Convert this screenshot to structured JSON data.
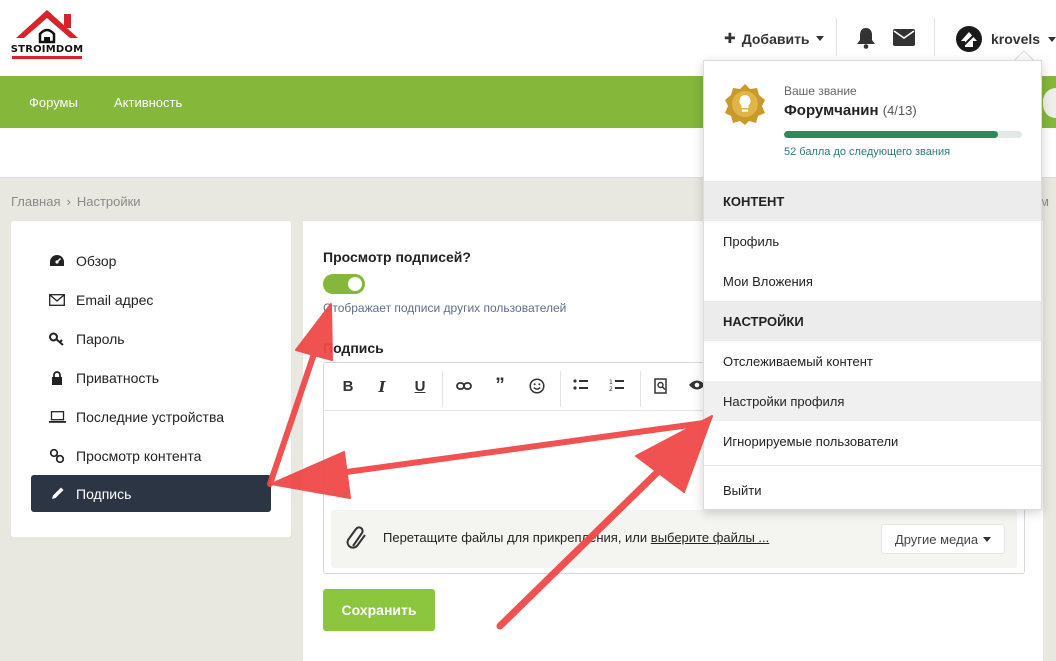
{
  "logo": {
    "text": "STROIMDOM"
  },
  "header": {
    "add_label": "Добавить",
    "username": "krovels"
  },
  "nav": {
    "items": [
      "Форумы",
      "Активность"
    ]
  },
  "breadcrumb": {
    "items": [
      "Главная",
      "Настройки"
    ]
  },
  "sidebar": {
    "items": [
      {
        "label": "Обзор",
        "icon": "dashboard-icon"
      },
      {
        "label": "Email адрес",
        "icon": "envelope-icon"
      },
      {
        "label": "Пароль",
        "icon": "key-icon"
      },
      {
        "label": "Приватность",
        "icon": "lock-icon"
      },
      {
        "label": "Последние устройства",
        "icon": "laptop-icon"
      },
      {
        "label": "Просмотр контента",
        "icon": "link-icon"
      },
      {
        "label": "Подпись",
        "icon": "pencil-icon",
        "active": true
      }
    ]
  },
  "main": {
    "view_signatures_label": "Просмотр подписей?",
    "view_signatures_hint": "Отображает подписи других пользователей",
    "view_signatures_enabled": true,
    "signature_label": "Подпись",
    "attach_text": "Перетащите файлы для прикрепления, или",
    "attach_link": "выберите файлы ...",
    "media_button": "Другие медиа",
    "save_button": "Сохранить"
  },
  "dropdown": {
    "rank_label": "Ваше звание",
    "rank_name": "Форумчанин",
    "rank_count": "(4/13)",
    "rank_progress": 0.9,
    "rank_next": "52 балла до следующего звания",
    "sections": [
      {
        "header": "КОНТЕНТ",
        "items": [
          "Профиль",
          "Мои Вложения"
        ]
      },
      {
        "header": "НАСТРОЙКИ",
        "items": [
          "Отслеживаемый контент",
          "Настройки профиля",
          "Игнорируемые пользователи"
        ]
      }
    ],
    "logout": "Выйти"
  },
  "right_edge_text": "м",
  "colors": {
    "accent_green": "#84b73a",
    "sidebar_active": "#2b3544",
    "save_button": "#8cc63f",
    "progress": "#2f8a5a",
    "arrow": "#f04848"
  }
}
